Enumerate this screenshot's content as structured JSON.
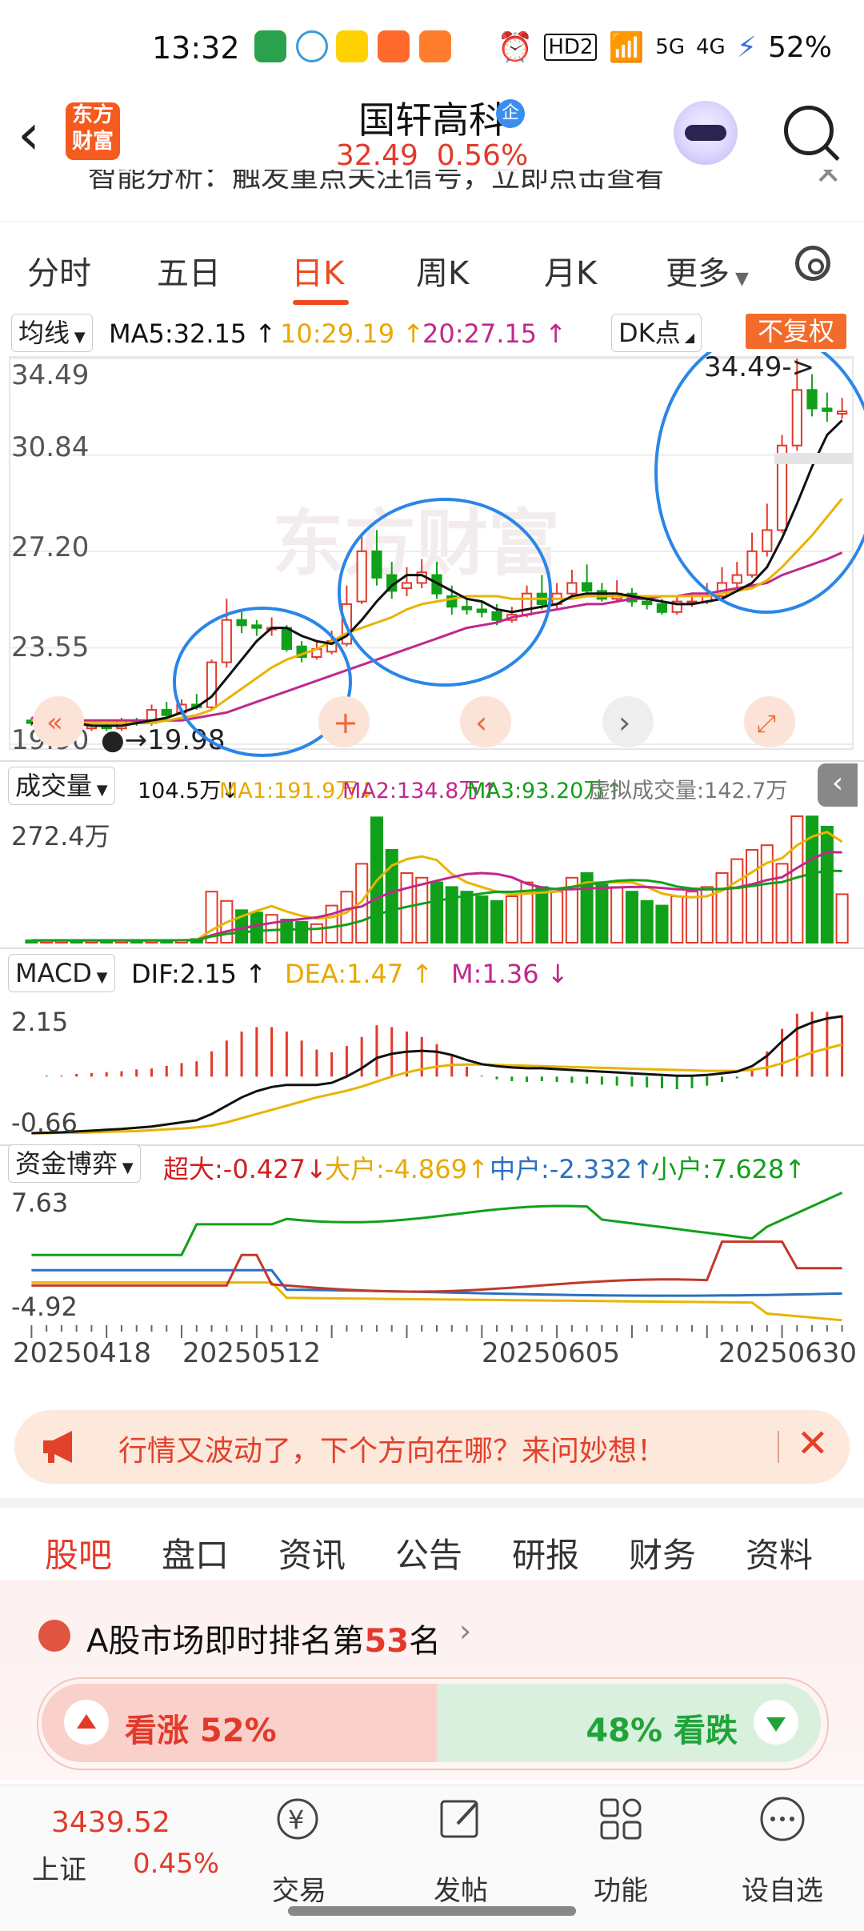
{
  "status_bar": {
    "time": "13:32",
    "battery": "52%",
    "net1": "HD2",
    "net2": "5G",
    "net3": "4G"
  },
  "header": {
    "stock_name": "国轩高科",
    "badge": "企",
    "price": "32.49",
    "change": "0.56%",
    "logo_line1": "东方",
    "logo_line2": "财富"
  },
  "ticker": {
    "text": "智能分析：触发重点关注信号，立即点击查看"
  },
  "period_tabs": [
    "分时",
    "五日",
    "日K",
    "周K",
    "月K",
    "更多"
  ],
  "active_tab": "日K",
  "ma_row": {
    "selector": "均线",
    "ma5": "MA5:32.15",
    "ma10": "10:29.19",
    "ma20": "20:27.15",
    "dk": "DK点",
    "fq": "不复权"
  },
  "kline": {
    "price_labels": [
      "34.49",
      "30.84",
      "27.20",
      "23.55",
      "19.90"
    ],
    "high_mark": "34.49->",
    "low_mark": "19.98"
  },
  "volume_row": {
    "selector": "成交量",
    "vol": "104.5万",
    "ma1": "MA1:191.9万",
    "ma2": "MA2:134.8万",
    "ma3": "MA3:93.20万",
    "virtual": "虚拟成交量:142.7万",
    "max": "272.4万"
  },
  "macd_row": {
    "selector": "MACD",
    "dif": "DIF:2.15",
    "dea": "DEA:1.47",
    "m": "M:1.36",
    "top": "2.15",
    "bottom": "-0.66"
  },
  "fund_row": {
    "selector": "资金博弈",
    "super": "超大:-0.427",
    "large": "大户:-4.869",
    "mid": "中户:-2.332",
    "small": "小户:7.628",
    "top": "7.63",
    "bottom": "-4.92"
  },
  "dates": [
    "20250418",
    "20250512",
    "20250605",
    "20250630"
  ],
  "promo": {
    "text": "行情又波动了，下个方向在哪？来问妙想！"
  },
  "sub_tabs": [
    "股吧",
    "盘口",
    "资讯",
    "公告",
    "研报",
    "财务",
    "资料"
  ],
  "ranking": {
    "prefix": "A股市场即时排名第",
    "rank": "53",
    "suffix": "名"
  },
  "sentiment": {
    "bull": "看涨 52%",
    "bear": "48% 看跌"
  },
  "bottom_nav": {
    "index_value": "3439.52",
    "index_name": "上证",
    "index_change": "0.45%",
    "items": [
      "交易",
      "发帖",
      "功能",
      "设自选"
    ]
  },
  "colors": {
    "up": "#e23a2a",
    "down": "#11a01a",
    "accent": "#ee4a1f",
    "annotation": "#2a86e8"
  },
  "chart_data": {
    "type": "candlestick",
    "ylim": [
      19.9,
      34.49
    ],
    "candles": [
      [
        20.8,
        20.7,
        20.9,
        20.6
      ],
      [
        20.7,
        20.7,
        20.8,
        20.6
      ],
      [
        20.6,
        20.7,
        20.8,
        20.5
      ],
      [
        20.7,
        20.6,
        20.8,
        20.5
      ],
      [
        20.5,
        20.6,
        20.7,
        20.4
      ],
      [
        20.6,
        20.5,
        20.7,
        20.4
      ],
      [
        20.5,
        20.8,
        20.9,
        20.4
      ],
      [
        20.8,
        20.7,
        20.9,
        20.6
      ],
      [
        20.7,
        21.2,
        21.4,
        20.6
      ],
      [
        21.2,
        21.0,
        21.5,
        20.9
      ],
      [
        21.1,
        21.4,
        21.6,
        21.0
      ],
      [
        21.4,
        21.3,
        21.8,
        21.2
      ],
      [
        21.3,
        23.0,
        23.1,
        21.2
      ],
      [
        23.0,
        24.6,
        25.4,
        22.8
      ],
      [
        24.6,
        24.4,
        24.9,
        24.1
      ],
      [
        24.4,
        24.3,
        24.6,
        24.0
      ],
      [
        24.3,
        24.3,
        24.7,
        24.0
      ],
      [
        24.3,
        23.5,
        24.4,
        23.4
      ],
      [
        23.6,
        23.2,
        23.8,
        23.0
      ],
      [
        23.2,
        23.5,
        23.8,
        23.1
      ],
      [
        23.4,
        23.8,
        24.2,
        23.3
      ],
      [
        23.7,
        25.2,
        25.9,
        23.6
      ],
      [
        25.3,
        27.2,
        27.8,
        25.2
      ],
      [
        27.2,
        26.2,
        28.0,
        25.9
      ],
      [
        26.3,
        25.7,
        26.8,
        25.4
      ],
      [
        25.8,
        26.0,
        26.6,
        25.5
      ],
      [
        26.0,
        26.4,
        26.9,
        25.8
      ],
      [
        26.3,
        25.6,
        26.8,
        25.4
      ],
      [
        25.5,
        25.1,
        25.9,
        24.8
      ],
      [
        25.1,
        25.0,
        25.4,
        24.8
      ],
      [
        25.0,
        24.9,
        25.3,
        24.7
      ],
      [
        24.9,
        24.6,
        25.2,
        24.4
      ],
      [
        24.6,
        24.8,
        25.1,
        24.5
      ],
      [
        24.8,
        25.6,
        25.9,
        24.7
      ],
      [
        25.6,
        25.2,
        26.3,
        25.0
      ],
      [
        25.2,
        25.6,
        26.0,
        25.0
      ],
      [
        25.6,
        26.0,
        26.5,
        25.5
      ],
      [
        26.0,
        25.7,
        26.7,
        25.5
      ],
      [
        25.7,
        25.4,
        26.0,
        25.3
      ],
      [
        25.4,
        25.6,
        26.1,
        25.3
      ],
      [
        25.6,
        25.3,
        25.8,
        25.1
      ],
      [
        25.3,
        25.2,
        25.5,
        25.0
      ],
      [
        25.2,
        24.9,
        25.4,
        24.8
      ],
      [
        24.9,
        25.3,
        25.5,
        24.8
      ],
      [
        25.3,
        25.3,
        25.6,
        25.1
      ],
      [
        25.3,
        25.5,
        26.0,
        25.2
      ],
      [
        25.5,
        26.0,
        26.6,
        25.4
      ],
      [
        26.0,
        26.3,
        26.8,
        25.8
      ],
      [
        26.3,
        27.2,
        27.9,
        26.2
      ],
      [
        27.2,
        28.0,
        29.0,
        27.0
      ],
      [
        28.0,
        31.2,
        31.6,
        27.9
      ],
      [
        31.2,
        33.3,
        34.49,
        31.0
      ],
      [
        33.3,
        32.6,
        33.9,
        32.3
      ],
      [
        32.6,
        32.5,
        33.2,
        32.1
      ],
      [
        32.4,
        32.49,
        33.0,
        32.2
      ]
    ],
    "ma5": [
      20.7,
      20.7,
      20.7,
      20.7,
      20.6,
      20.6,
      20.6,
      20.7,
      20.8,
      20.9,
      21.1,
      21.3,
      21.7,
      22.4,
      23.1,
      23.8,
      24.3,
      24.3,
      24.0,
      23.8,
      23.7,
      24.0,
      24.6,
      25.3,
      25.9,
      26.3,
      26.3,
      26.0,
      25.7,
      25.4,
      25.3,
      25.0,
      24.9,
      25.0,
      25.1,
      25.2,
      25.5,
      25.6,
      25.6,
      25.6,
      25.5,
      25.4,
      25.3,
      25.2,
      25.2,
      25.3,
      25.4,
      25.7,
      26.0,
      26.6,
      27.7,
      29.0,
      30.4,
      31.6,
      32.15
    ],
    "ma10": [
      20.8,
      20.8,
      20.7,
      20.7,
      20.7,
      20.7,
      20.7,
      20.7,
      20.7,
      20.8,
      20.9,
      21.0,
      21.2,
      21.6,
      22.0,
      22.4,
      22.8,
      23.1,
      23.3,
      23.5,
      23.8,
      24.1,
      24.3,
      24.5,
      24.7,
      25.0,
      25.2,
      25.3,
      25.4,
      25.5,
      25.5,
      25.5,
      25.4,
      25.4,
      25.4,
      25.4,
      25.4,
      25.5,
      25.5,
      25.5,
      25.5,
      25.5,
      25.5,
      25.5,
      25.5,
      25.5,
      25.6,
      25.7,
      25.8,
      26.1,
      26.6,
      27.2,
      27.8,
      28.5,
      29.19
    ],
    "ma20": [
      20.9,
      20.9,
      20.9,
      20.8,
      20.8,
      20.8,
      20.8,
      20.8,
      20.8,
      20.8,
      20.8,
      20.9,
      21.0,
      21.1,
      21.3,
      21.5,
      21.7,
      21.9,
      22.1,
      22.3,
      22.5,
      22.7,
      22.9,
      23.1,
      23.3,
      23.5,
      23.7,
      23.9,
      24.1,
      24.3,
      24.4,
      24.5,
      24.7,
      24.8,
      24.9,
      25.0,
      25.1,
      25.2,
      25.2,
      25.3,
      25.4,
      25.4,
      25.5,
      25.5,
      25.6,
      25.6,
      25.7,
      25.8,
      25.9,
      26.0,
      26.3,
      26.5,
      26.7,
      26.9,
      27.15
    ],
    "volume_max": 272.4,
    "volume": [
      5,
      5,
      5,
      5,
      5,
      5,
      5,
      5,
      5,
      6,
      6,
      8,
      110,
      90,
      70,
      65,
      60,
      50,
      45,
      40,
      80,
      110,
      170,
      270,
      200,
      150,
      140,
      130,
      120,
      110,
      100,
      90,
      100,
      130,
      120,
      110,
      140,
      150,
      130,
      120,
      110,
      90,
      80,
      100,
      110,
      120,
      150,
      180,
      200,
      210,
      170,
      290,
      272,
      250,
      104.5
    ],
    "macd_ylim": [
      -0.66,
      2.15
    ],
    "dif": [
      -0.66,
      -0.65,
      -0.64,
      -0.62,
      -0.6,
      -0.58,
      -0.56,
      -0.53,
      -0.5,
      -0.45,
      -0.4,
      -0.35,
      -0.2,
      0.0,
      0.2,
      0.35,
      0.45,
      0.5,
      0.5,
      0.5,
      0.55,
      0.7,
      0.9,
      1.15,
      1.25,
      1.3,
      1.32,
      1.3,
      1.22,
      1.1,
      1.0,
      0.95,
      0.92,
      0.9,
      0.9,
      0.88,
      0.86,
      0.84,
      0.82,
      0.8,
      0.78,
      0.76,
      0.74,
      0.72,
      0.72,
      0.74,
      0.78,
      0.82,
      0.95,
      1.2,
      1.55,
      1.85,
      2.0,
      2.1,
      2.15
    ],
    "dea": [
      -0.66,
      -0.66,
      -0.65,
      -0.65,
      -0.64,
      -0.63,
      -0.62,
      -0.61,
      -0.59,
      -0.57,
      -0.55,
      -0.52,
      -0.48,
      -0.4,
      -0.3,
      -0.2,
      -0.1,
      0.0,
      0.1,
      0.2,
      0.28,
      0.36,
      0.46,
      0.58,
      0.7,
      0.8,
      0.88,
      0.94,
      0.98,
      0.99,
      0.99,
      0.98,
      0.97,
      0.96,
      0.95,
      0.94,
      0.93,
      0.92,
      0.91,
      0.9,
      0.89,
      0.88,
      0.87,
      0.86,
      0.85,
      0.84,
      0.84,
      0.84,
      0.86,
      0.92,
      1.02,
      1.15,
      1.28,
      1.38,
      1.47
    ],
    "fund_ylim": [
      -4.92,
      7.63
    ]
  }
}
